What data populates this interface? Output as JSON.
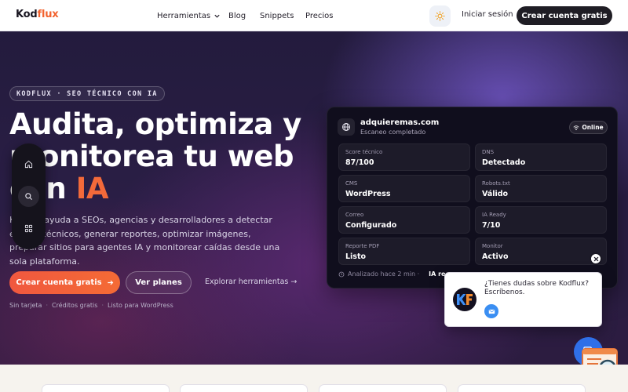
{
  "header": {
    "logo_main": "Kod",
    "logo_accent": "flux",
    "nav": {
      "tools": "Herramientas",
      "blog": "Blog",
      "snippets": "Snippets",
      "pricing": "Precios"
    },
    "login": "Iniciar sesión",
    "cta": "Crear cuenta gratis"
  },
  "hero": {
    "badge": "KODFLUX · SEO TÉCNICO CON IA",
    "headline_part1": "Audita, optimiza y monitorea tu web con ",
    "headline_accent": "IA",
    "description": "Kodflux ayuda a SEOs, agencias y desarrolladores a detectar errores técnicos, generar reportes, optimizar imágenes, preparar sitios para agentes IA y monitorear caídas desde una sola plataforma.",
    "primary_cta": "Crear cuenta gratis",
    "secondary_cta": "Ver planes",
    "explore_link": "Explorar herramientas →",
    "footnotes": [
      "Sin tarjeta",
      "Créditos gratis",
      "Listo para WordPress"
    ]
  },
  "dashboard": {
    "domain": "adquieremas.com",
    "scan_status": "Escaneo completado",
    "status_badge": "Online",
    "stats": [
      {
        "label": "Score técnico",
        "value": "87/100"
      },
      {
        "label": "DNS",
        "value": "Detectado"
      },
      {
        "label": "CMS",
        "value": "WordPress"
      },
      {
        "label": "Robots.txt",
        "value": "Válido"
      },
      {
        "label": "Correo",
        "value": "Configurado"
      },
      {
        "label": "IA Ready",
        "value": "7/10"
      },
      {
        "label": "Reporte PDF",
        "value": "Listo"
      },
      {
        "label": "Monitor",
        "value": "Activo"
      }
    ],
    "footer_time": "Analizado hace 2 min ·",
    "footer_ai": "IA recom..."
  },
  "chat": {
    "message": "¿Tienes dudas sobre Kodflux? Escríbenos."
  },
  "icons": {
    "theme": "sun-icon",
    "vbar": [
      "home-icon",
      "search-icon",
      "grid-icon"
    ],
    "chat_avatar": "kodflux-logo",
    "chat_mail": "mail-icon",
    "chat_close": "close-icon",
    "chat_fab": "chat-icon"
  },
  "colors": {
    "accent_orange": "#f2622e",
    "dark_button": "#1f1d24",
    "chat_blue": "#2f6fe8"
  }
}
